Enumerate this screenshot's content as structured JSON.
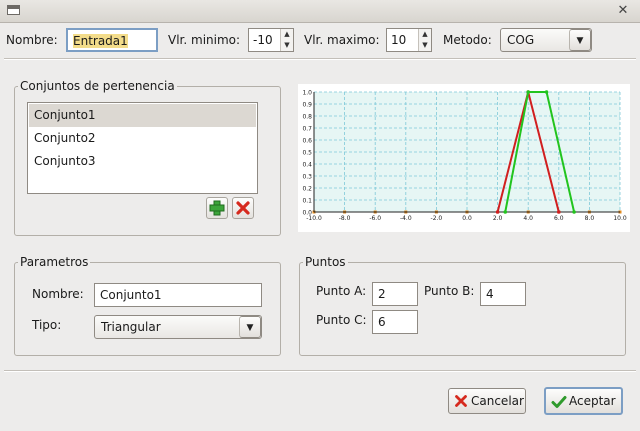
{
  "window": {
    "title": ""
  },
  "header": {
    "nombre_label": "Nombre:",
    "nombre_value": "Entrada1",
    "vlr_min_label": "Vlr. minimo:",
    "vlr_min_value": "-10",
    "vlr_max_label": "Vlr. maximo:",
    "vlr_max_value": "10",
    "metodo_label": "Metodo:",
    "metodo_value": "COG"
  },
  "conjuntos": {
    "title": "Conjuntos de pertenencia",
    "items": [
      {
        "label": "Conjunto1",
        "selected": true
      },
      {
        "label": "Conjunto2",
        "selected": false
      },
      {
        "label": "Conjunto3",
        "selected": false
      }
    ],
    "add_icon": "plus-icon",
    "remove_icon": "x-icon"
  },
  "chart_data": {
    "type": "line",
    "title": "",
    "xlabel": "",
    "ylabel": "",
    "xlim": [
      -10,
      10
    ],
    "ylim": [
      0,
      1
    ],
    "x_ticks": [
      "-10.0",
      "-8.0",
      "-6.0",
      "-4.0",
      "-2.0",
      "0.0",
      "2.0",
      "4.0",
      "6.0",
      "8.0",
      "10.0"
    ],
    "y_ticks": [
      "0.0",
      "0.1",
      "0.2",
      "0.3",
      "0.4",
      "0.5",
      "0.6",
      "0.7",
      "0.8",
      "0.9",
      "1.0"
    ],
    "grid": true,
    "background_color": "#e6f6f4",
    "grid_color": "#7fc9d8",
    "series": [
      {
        "color": "#d11f1f",
        "x": [
          2,
          4,
          6
        ],
        "y": [
          0,
          1,
          0
        ]
      },
      {
        "color": "#22c41e",
        "x": [
          2.5,
          4,
          5.2,
          7
        ],
        "y": [
          0,
          1,
          1,
          0
        ]
      }
    ]
  },
  "parametros": {
    "title": "Parametros",
    "nombre_label": "Nombre:",
    "nombre_value": "Conjunto1",
    "tipo_label": "Tipo:",
    "tipo_value": "Triangular"
  },
  "puntos": {
    "title": "Puntos",
    "a_label": "Punto A:",
    "a_value": "2",
    "b_label": "Punto B:",
    "b_value": "4",
    "c_label": "Punto C:",
    "c_value": "6"
  },
  "footer": {
    "cancel_label": "Cancelar",
    "cancel_icon": "cancel-x-icon",
    "accept_label": "Aceptar",
    "accept_icon": "checkmark-icon"
  }
}
